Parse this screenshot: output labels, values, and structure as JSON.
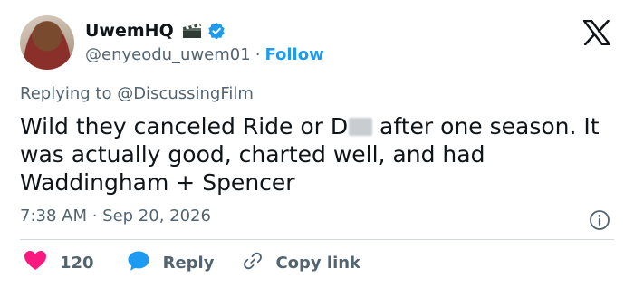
{
  "author": {
    "name": "UwemHQ",
    "handle": "@enyeodu_uwem01",
    "separator": "·",
    "follow_label": "Follow"
  },
  "tweet": {
    "replying_to": "Replying to @DiscussingFilm",
    "text_before_redaction": "Wild they canceled Ride or D",
    "text_after_redaction": " after one season. It was actually good, charted well, and had Waddingham + Spencer",
    "timestamp": "7:38 AM · Sep 20, 2026"
  },
  "actions": {
    "like_count": "120",
    "reply_label": "Reply",
    "copy_label": "Copy link"
  },
  "colors": {
    "text": "#0f1419",
    "secondary": "#536471",
    "accent": "#1d9bf0",
    "like": "#f91880",
    "divider": "#cfd9de"
  },
  "icons": [
    "clapper-board-icon",
    "verified-badge-icon",
    "x-logo-icon",
    "info-icon",
    "heart-icon",
    "reply-bubble-icon",
    "link-icon"
  ]
}
